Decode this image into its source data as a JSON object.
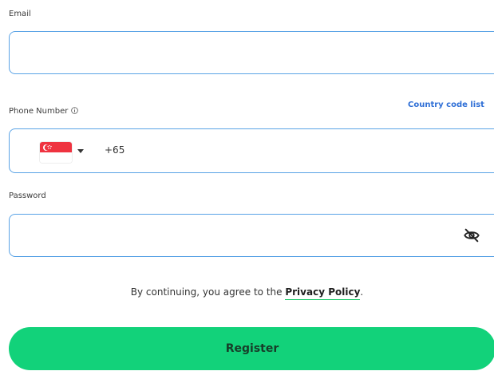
{
  "email": {
    "label": "Email",
    "value": ""
  },
  "phone": {
    "label": "Phone Number",
    "info_icon": "info-icon",
    "country_code_link": "Country code list",
    "flag": "singapore-flag",
    "dial_code": "+65",
    "value": ""
  },
  "password": {
    "label": "Password",
    "value": "",
    "toggle_icon": "eye-slash-icon"
  },
  "consent": {
    "prefix": "By continuing, you agree to the ",
    "link": "Privacy Policy",
    "suffix": "."
  },
  "register_button": "Register",
  "colors": {
    "field_border": "#5aa3e6",
    "link_blue": "#2f6fd6",
    "accent_green": "#12d27a",
    "underline_green": "#1ec96b"
  }
}
